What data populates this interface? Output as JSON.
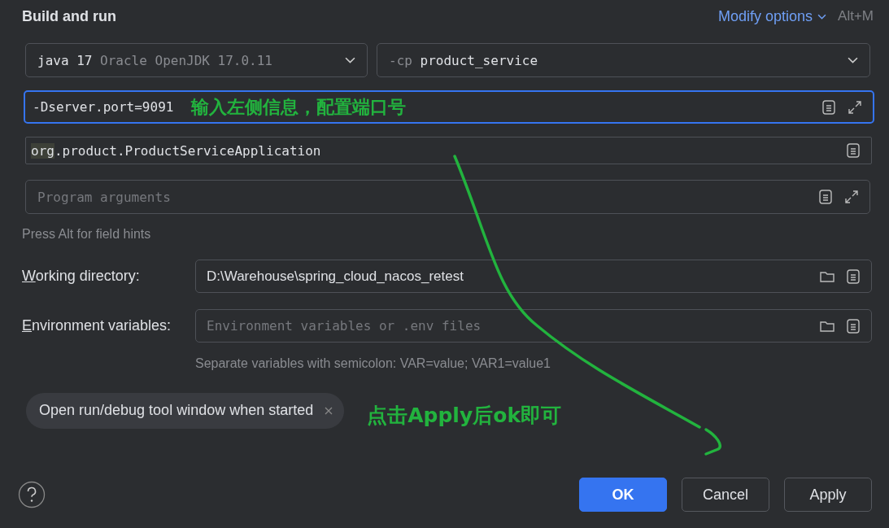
{
  "section_title": "Build and run",
  "modify_options": {
    "label": "Modify options",
    "shortcut": "Alt+M"
  },
  "jre": {
    "value": "java 17",
    "detail": "Oracle OpenJDK 17.0.11"
  },
  "module": {
    "prefix": "-cp",
    "value": "product_service"
  },
  "vm_options": {
    "value": "-Dserver.port=9091",
    "focused": true
  },
  "main_class": {
    "highlight": "org",
    "value": ".product.ProductServiceApplication"
  },
  "program_arguments": {
    "placeholder": "Program arguments"
  },
  "field_hint": "Press Alt for field hints",
  "working_directory": {
    "label": "Working directory:",
    "value": "D:\\Warehouse\\spring_cloud_nacos_retest"
  },
  "environment_variables": {
    "label": "Environment variables:",
    "placeholder": "Environment variables or .env files",
    "hint": "Separate variables with semicolon: VAR=value; VAR1=value1"
  },
  "chips": [
    {
      "label": "Open run/debug tool window when started"
    }
  ],
  "annotations": [
    {
      "kind": "field_note",
      "text": "输入左侧信息，配置端口号"
    },
    {
      "kind": "footer_note",
      "text": "点击Apply后ok即可"
    }
  ],
  "buttons": [
    {
      "label": "OK",
      "primary": true
    },
    {
      "label": "Cancel",
      "primary": false
    },
    {
      "label": "Apply",
      "primary": false
    }
  ]
}
